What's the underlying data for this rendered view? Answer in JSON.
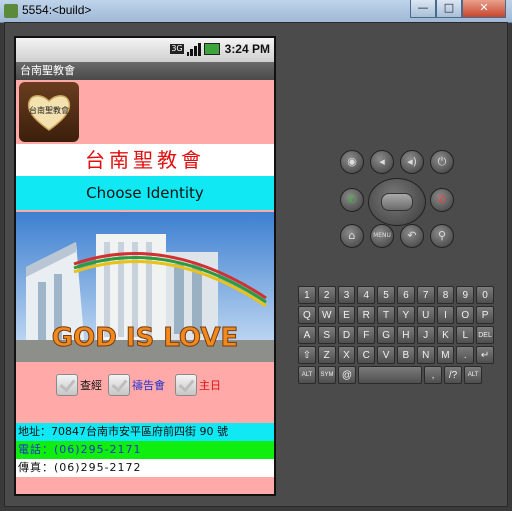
{
  "window": {
    "title": "5554:<build>",
    "buttons": {
      "minimize": "—",
      "maximize": "□",
      "close": "✕"
    }
  },
  "status_bar": {
    "network": "3G",
    "time": "3:24 PM"
  },
  "app": {
    "title": "台南聖教會",
    "logo_text": "台南聖教會",
    "church_name": "台南聖教會",
    "identity_heading": "Choose Identity",
    "photo_text": "GOD IS LOVE",
    "choices": [
      {
        "label": "查經",
        "color": "#111111"
      },
      {
        "label": "禱告會",
        "color": "#2030d0"
      },
      {
        "label": "主日",
        "color": "#e01010"
      }
    ],
    "address": "地址：70847台南市安平區府前四街 90 號",
    "phone": "電話：(06)295-2171",
    "fax": "傳真：(06)295-2172"
  },
  "controls": {
    "top_row_icons": [
      "camera-icon",
      "volume-down-icon",
      "volume-up-icon",
      "power-icon"
    ],
    "call_icon": "call-icon",
    "hangup_icon": "end-call-icon",
    "bottom_row": {
      "home": "⌂",
      "menu": "MENU",
      "back": "↶",
      "search": "⚲"
    }
  },
  "keyboard": {
    "row1": [
      {
        "k": "1",
        "s": "!"
      },
      {
        "k": "2",
        "s": "@"
      },
      {
        "k": "3",
        "s": "#"
      },
      {
        "k": "4",
        "s": "$"
      },
      {
        "k": "5",
        "s": "%"
      },
      {
        "k": "6",
        "s": "^"
      },
      {
        "k": "7",
        "s": "&"
      },
      {
        "k": "8",
        "s": "*"
      },
      {
        "k": "9",
        "s": "("
      },
      {
        "k": "0",
        "s": ")"
      }
    ],
    "row2": [
      "Q",
      "W",
      "E",
      "R",
      "T",
      "Y",
      "U",
      "I",
      "O",
      "P"
    ],
    "row3": [
      "A",
      "S",
      "D",
      "F",
      "G",
      "H",
      "J",
      "K",
      "L",
      "DEL"
    ],
    "row4": [
      "⇧",
      "Z",
      "X",
      "C",
      "V",
      "B",
      "N",
      "M",
      ".",
      "↵"
    ],
    "row5": [
      "ALT",
      "SYM",
      "@",
      "",
      ",",
      "/?",
      "ALT"
    ]
  },
  "colors": {
    "screen_bg": "#ffa9a9",
    "cyan": "#10e8f4",
    "green": "#10ee10",
    "red": "#e01010",
    "blue": "#2030d0"
  }
}
